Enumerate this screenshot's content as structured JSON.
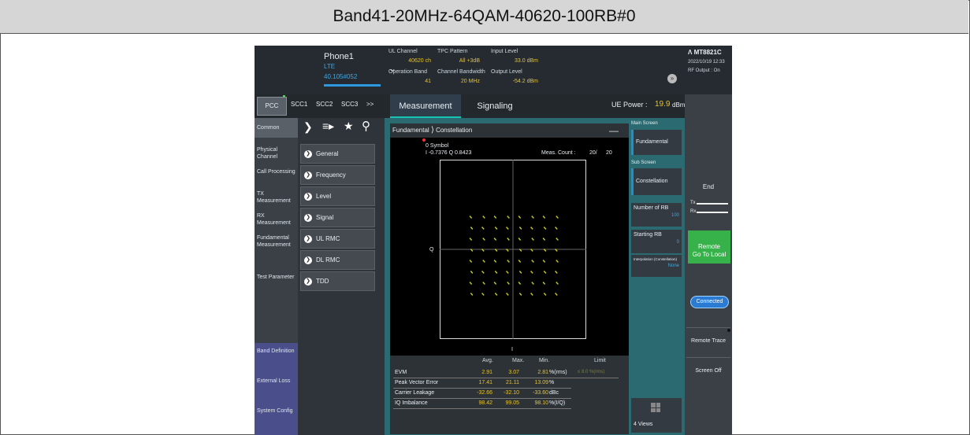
{
  "window_title": "Band41-20MHz-64QAM-40620-100RB#0",
  "header": {
    "phone_name": "Phone1",
    "phone_rat": "LTE",
    "phone_channel": "40.105#052",
    "ul_channel_label": "UL Channel",
    "ul_channel_value": "40620 ch",
    "tpc_label": "TPC Pattern",
    "tpc_value": "All +3dB",
    "input_level_label": "Input Level",
    "input_level_value": "33.0 dBm",
    "operation_band_label": "Operation Band",
    "operation_band_value": "41",
    "channel_bw_label": "Channel Bandwidth",
    "channel_bw_value": "20 MHz",
    "output_level_label": "Output Level",
    "output_level_value": "-54.2 dBm",
    "model": "MT8821C",
    "datetime": "2022/10/19 12:33",
    "rf_output": "RF Output : On"
  },
  "carrier_tabs": [
    "PCC",
    "SCC1",
    "SCC2",
    "SCC3",
    ">>"
  ],
  "nav": {
    "common": "Common",
    "items": [
      "Physical Channel",
      "Call Processing",
      "TX Measurement",
      "RX Measurement",
      "Fundamental Measurement",
      "Test Parameter",
      "Band Definition",
      "External Loss",
      "System Config"
    ]
  },
  "menu": {
    "items": [
      "General",
      "Frequency",
      "Level",
      "Signal",
      "UL RMC",
      "DL RMC",
      "TDD"
    ]
  },
  "main_tabs": [
    "Measurement",
    "Signaling"
  ],
  "ue_power": {
    "label": "UE Power :",
    "value": "19.9",
    "unit": "dBm"
  },
  "plot": {
    "breadcrumb_1": "Fundamental",
    "breadcrumb_2": "Constellation",
    "symbol_label": "0 Symbol",
    "iq_readout": "I -0.7376 Q 0.8423",
    "meas_count_label": "Meas. Count :",
    "meas_count_current": "20/",
    "meas_count_total": "20",
    "axis_q": "Q",
    "axis_i": "I"
  },
  "side_panel": {
    "main_screen_label": "Main Screen",
    "main_screen_value": "Fundamental",
    "sub_screen_label": "Sub Screen",
    "sub_screen_value": "Constellation",
    "num_rb_label": "Number of RB",
    "num_rb_value": "100",
    "starting_rb_label": "Starting RB",
    "starting_rb_value": "0",
    "interp_label": "Interpolation (Constellation)",
    "interp_value": "None",
    "views_label": "4 Views"
  },
  "right_bar": {
    "end": "End",
    "tx": "Tx",
    "rx": "Rx",
    "remote": "Remote",
    "go_to_local": "Go To Local",
    "connected": "Connected",
    "remote_trace": "Remote Trace",
    "screen_off": "Screen Off"
  },
  "results": {
    "headers": [
      "Avg.",
      "Max.",
      "Min.",
      "Limit"
    ],
    "rows": [
      {
        "name": "EVM",
        "avg": "2.91",
        "max": "3.07",
        "min": "2.81",
        "unit": "%(rms)",
        "limit": "≤ 8.0 %(rms)"
      },
      {
        "name": "Peak Vector Error",
        "avg": "17.41",
        "max": "21.11",
        "min": "13.09",
        "unit": "%",
        "limit": ""
      },
      {
        "name": "Carrier Leakage",
        "avg": "-32.66",
        "max": "-32.10",
        "min": "-33.60",
        "unit": "dBc",
        "limit": ""
      },
      {
        "name": "IQ Imbalance",
        "avg": "98.42",
        "max": "99.05",
        "min": "98.10",
        "unit": "%(I/Q)",
        "limit": ""
      }
    ]
  },
  "colors": {
    "accent_blue": "#41a6e0",
    "value_yellow": "#e6c32b",
    "panel_teal": "#2b6a70",
    "remote_green": "#37b24a",
    "constellation_point": "#d6d62a"
  }
}
